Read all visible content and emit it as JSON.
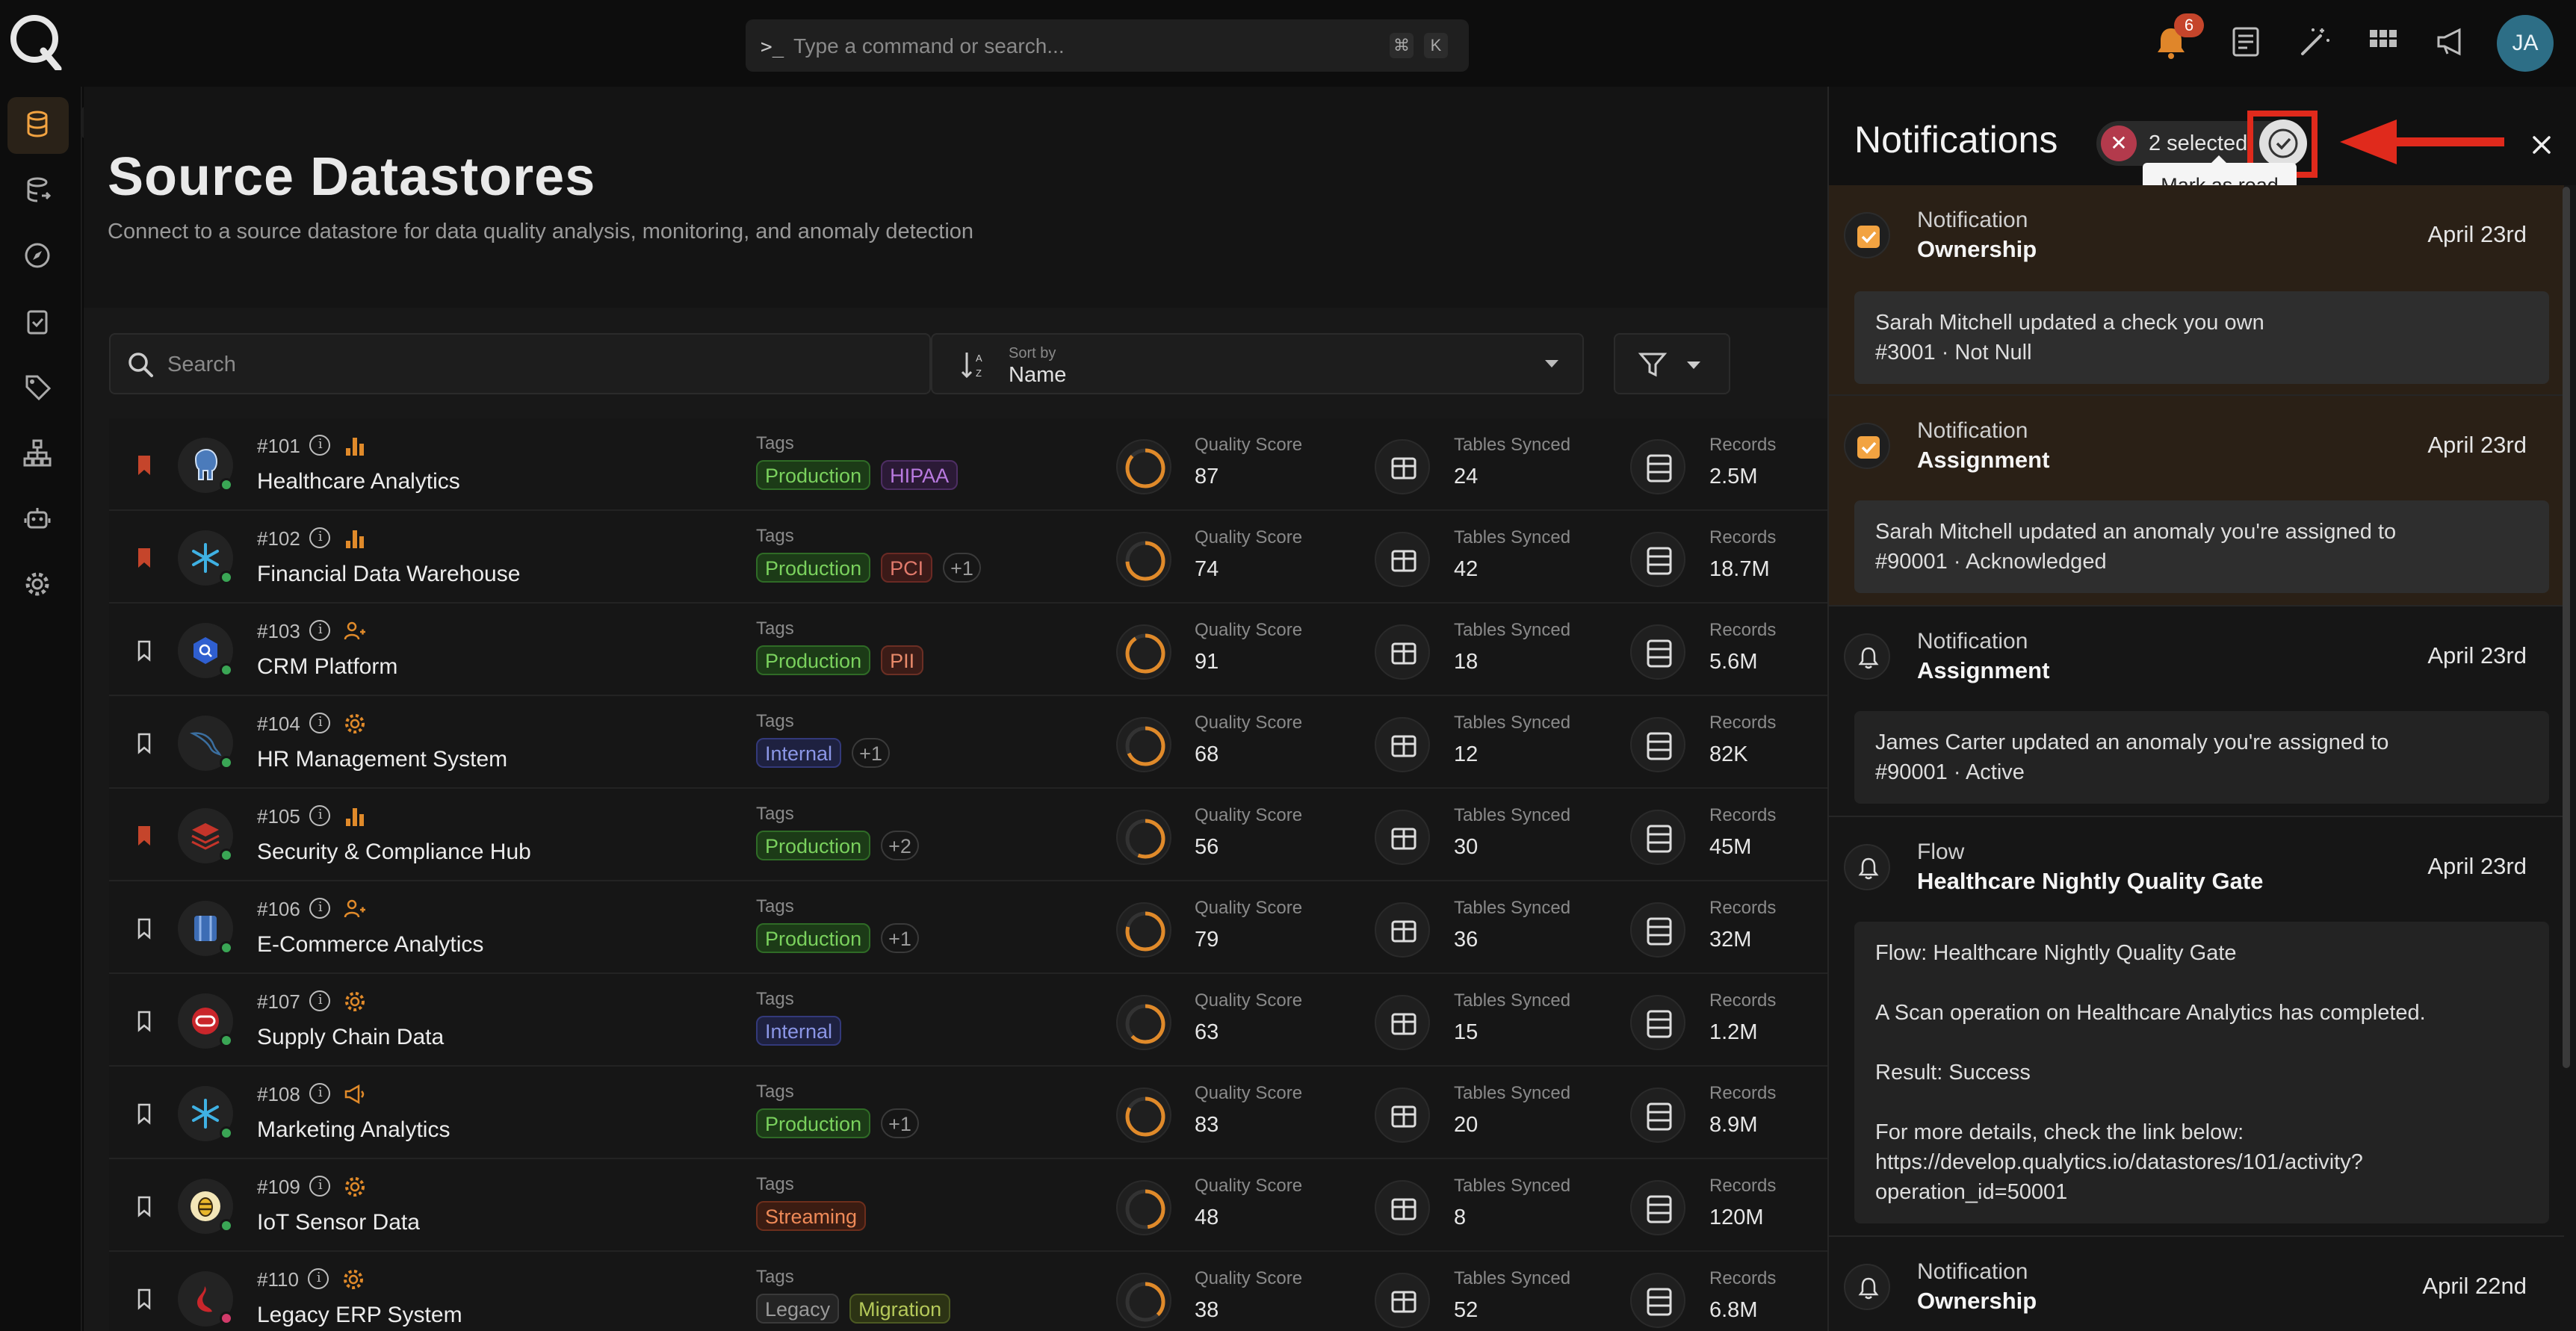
{
  "header": {
    "command_placeholder": "Type a command or search...",
    "kbd_mod": "⌘",
    "kbd_key": "K",
    "notification_count": "6",
    "avatar_initials": "JA"
  },
  "page": {
    "title": "Source Datastores",
    "subtitle": "Connect to a source datastore for data quality analysis, monitoring, and anomaly detection"
  },
  "toolbar": {
    "search_placeholder": "Search",
    "sort_label": "Sort by",
    "sort_value": "Name"
  },
  "labels": {
    "tags": "Tags",
    "quality": "Quality Score",
    "tables": "Tables Synced",
    "records": "Records"
  },
  "datastores": [
    {
      "id": "#101",
      "name": "Healthcare Analytics",
      "tags": [
        "Production",
        "HIPAA"
      ],
      "more": "",
      "quality": "87",
      "tables": "24",
      "records": "2.5M"
    },
    {
      "id": "#102",
      "name": "Financial Data Warehouse",
      "tags": [
        "Production",
        "PCI"
      ],
      "more": "+1",
      "quality": "74",
      "tables": "42",
      "records": "18.7M"
    },
    {
      "id": "#103",
      "name": "CRM Platform",
      "tags": [
        "Production",
        "PII"
      ],
      "more": "",
      "quality": "91",
      "tables": "18",
      "records": "5.6M"
    },
    {
      "id": "#104",
      "name": "HR Management System",
      "tags": [
        "Internal"
      ],
      "more": "+1",
      "quality": "68",
      "tables": "12",
      "records": "82K"
    },
    {
      "id": "#105",
      "name": "Security & Compliance Hub",
      "tags": [
        "Production"
      ],
      "more": "+2",
      "quality": "56",
      "tables": "30",
      "records": "45M"
    },
    {
      "id": "#106",
      "name": "E-Commerce Analytics",
      "tags": [
        "Production"
      ],
      "more": "+1",
      "quality": "79",
      "tables": "36",
      "records": "32M"
    },
    {
      "id": "#107",
      "name": "Supply Chain Data",
      "tags": [
        "Internal"
      ],
      "more": "",
      "quality": "63",
      "tables": "15",
      "records": "1.2M"
    },
    {
      "id": "#108",
      "name": "Marketing Analytics",
      "tags": [
        "Production"
      ],
      "more": "+1",
      "quality": "83",
      "tables": "20",
      "records": "8.9M"
    },
    {
      "id": "#109",
      "name": "IoT Sensor Data",
      "tags": [
        "Streaming"
      ],
      "more": "",
      "quality": "48",
      "tables": "8",
      "records": "120M"
    },
    {
      "id": "#110",
      "name": "Legacy ERP System",
      "tags": [
        "Legacy",
        "Migration"
      ],
      "more": "",
      "quality": "38",
      "tables": "52",
      "records": "6.8M"
    }
  ],
  "notifications": {
    "title": "Notifications",
    "selected": "2 selected",
    "mark_read_tooltip": "Mark as read",
    "items": [
      {
        "category": "Notification",
        "title": "Ownership",
        "date": "April 23rd",
        "body1": "Sarah Mitchell updated a check you own",
        "body2": "#3001 · Not Null"
      },
      {
        "category": "Notification",
        "title": "Assignment",
        "date": "April 23rd",
        "body1": "Sarah Mitchell updated an anomaly you're assigned to",
        "body2": "#90001 · Acknowledged"
      },
      {
        "category": "Notification",
        "title": "Assignment",
        "date": "April 23rd",
        "body1": "James Carter updated an anomaly you're assigned to",
        "body2": "#90001 · Active"
      },
      {
        "category": "Flow",
        "title": "Healthcare Nightly Quality Gate",
        "date": "April 23rd",
        "body1": "Flow: Healthcare Nightly Quality Gate",
        "body2": "A Scan operation on Healthcare Analytics has completed.",
        "body3": "Result: Success",
        "body4": "For more details, check the link below:",
        "body5": "https://develop.qualytics.io/datastores/101/activity?",
        "body6": "operation_id=50001"
      },
      {
        "category": "Notification",
        "title": "Ownership",
        "date": "April 22nd"
      }
    ]
  },
  "colors": {
    "accent": "#f2a341",
    "highlight": "#e02a1c",
    "success": "#3aa655"
  }
}
